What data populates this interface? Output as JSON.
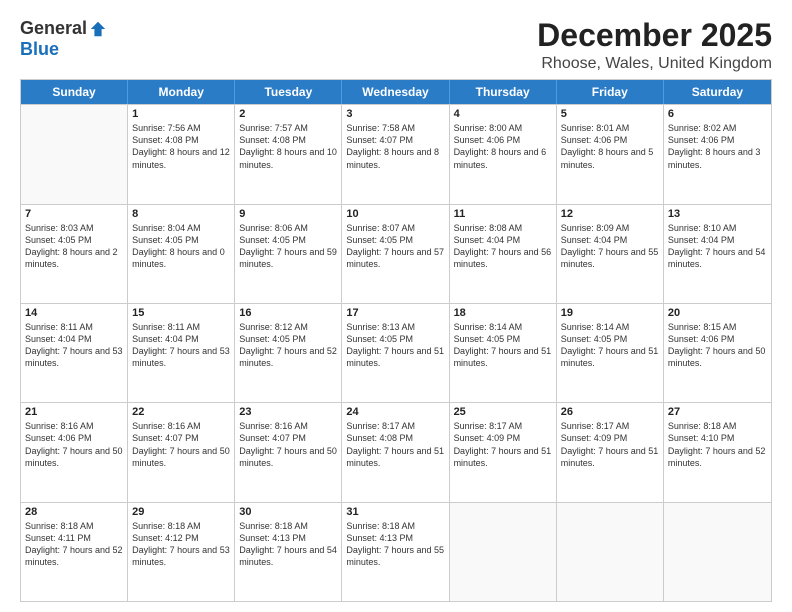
{
  "header": {
    "logo_general": "General",
    "logo_blue": "Blue",
    "title": "December 2025",
    "subtitle": "Rhoose, Wales, United Kingdom"
  },
  "days": [
    "Sunday",
    "Monday",
    "Tuesday",
    "Wednesday",
    "Thursday",
    "Friday",
    "Saturday"
  ],
  "weeks": [
    [
      {
        "day": "",
        "empty": true
      },
      {
        "day": "1",
        "rise": "7:56 AM",
        "set": "4:08 PM",
        "daylight": "8 hours and 12 minutes."
      },
      {
        "day": "2",
        "rise": "7:57 AM",
        "set": "4:08 PM",
        "daylight": "8 hours and 10 minutes."
      },
      {
        "day": "3",
        "rise": "7:58 AM",
        "set": "4:07 PM",
        "daylight": "8 hours and 8 minutes."
      },
      {
        "day": "4",
        "rise": "8:00 AM",
        "set": "4:06 PM",
        "daylight": "8 hours and 6 minutes."
      },
      {
        "day": "5",
        "rise": "8:01 AM",
        "set": "4:06 PM",
        "daylight": "8 hours and 5 minutes."
      },
      {
        "day": "6",
        "rise": "8:02 AM",
        "set": "4:06 PM",
        "daylight": "8 hours and 3 minutes."
      }
    ],
    [
      {
        "day": "7",
        "rise": "8:03 AM",
        "set": "4:05 PM",
        "daylight": "8 hours and 2 minutes."
      },
      {
        "day": "8",
        "rise": "8:04 AM",
        "set": "4:05 PM",
        "daylight": "8 hours and 0 minutes."
      },
      {
        "day": "9",
        "rise": "8:06 AM",
        "set": "4:05 PM",
        "daylight": "7 hours and 59 minutes."
      },
      {
        "day": "10",
        "rise": "8:07 AM",
        "set": "4:05 PM",
        "daylight": "7 hours and 57 minutes."
      },
      {
        "day": "11",
        "rise": "8:08 AM",
        "set": "4:04 PM",
        "daylight": "7 hours and 56 minutes."
      },
      {
        "day": "12",
        "rise": "8:09 AM",
        "set": "4:04 PM",
        "daylight": "7 hours and 55 minutes."
      },
      {
        "day": "13",
        "rise": "8:10 AM",
        "set": "4:04 PM",
        "daylight": "7 hours and 54 minutes."
      }
    ],
    [
      {
        "day": "14",
        "rise": "8:11 AM",
        "set": "4:04 PM",
        "daylight": "7 hours and 53 minutes."
      },
      {
        "day": "15",
        "rise": "8:11 AM",
        "set": "4:04 PM",
        "daylight": "7 hours and 53 minutes."
      },
      {
        "day": "16",
        "rise": "8:12 AM",
        "set": "4:05 PM",
        "daylight": "7 hours and 52 minutes."
      },
      {
        "day": "17",
        "rise": "8:13 AM",
        "set": "4:05 PM",
        "daylight": "7 hours and 51 minutes."
      },
      {
        "day": "18",
        "rise": "8:14 AM",
        "set": "4:05 PM",
        "daylight": "7 hours and 51 minutes."
      },
      {
        "day": "19",
        "rise": "8:14 AM",
        "set": "4:05 PM",
        "daylight": "7 hours and 51 minutes."
      },
      {
        "day": "20",
        "rise": "8:15 AM",
        "set": "4:06 PM",
        "daylight": "7 hours and 50 minutes."
      }
    ],
    [
      {
        "day": "21",
        "rise": "8:16 AM",
        "set": "4:06 PM",
        "daylight": "7 hours and 50 minutes."
      },
      {
        "day": "22",
        "rise": "8:16 AM",
        "set": "4:07 PM",
        "daylight": "7 hours and 50 minutes."
      },
      {
        "day": "23",
        "rise": "8:16 AM",
        "set": "4:07 PM",
        "daylight": "7 hours and 50 minutes."
      },
      {
        "day": "24",
        "rise": "8:17 AM",
        "set": "4:08 PM",
        "daylight": "7 hours and 51 minutes."
      },
      {
        "day": "25",
        "rise": "8:17 AM",
        "set": "4:09 PM",
        "daylight": "7 hours and 51 minutes."
      },
      {
        "day": "26",
        "rise": "8:17 AM",
        "set": "4:09 PM",
        "daylight": "7 hours and 51 minutes."
      },
      {
        "day": "27",
        "rise": "8:18 AM",
        "set": "4:10 PM",
        "daylight": "7 hours and 52 minutes."
      }
    ],
    [
      {
        "day": "28",
        "rise": "8:18 AM",
        "set": "4:11 PM",
        "daylight": "7 hours and 52 minutes."
      },
      {
        "day": "29",
        "rise": "8:18 AM",
        "set": "4:12 PM",
        "daylight": "7 hours and 53 minutes."
      },
      {
        "day": "30",
        "rise": "8:18 AM",
        "set": "4:13 PM",
        "daylight": "7 hours and 54 minutes."
      },
      {
        "day": "31",
        "rise": "8:18 AM",
        "set": "4:13 PM",
        "daylight": "7 hours and 55 minutes."
      },
      {
        "day": "",
        "empty": true
      },
      {
        "day": "",
        "empty": true
      },
      {
        "day": "",
        "empty": true
      }
    ]
  ]
}
